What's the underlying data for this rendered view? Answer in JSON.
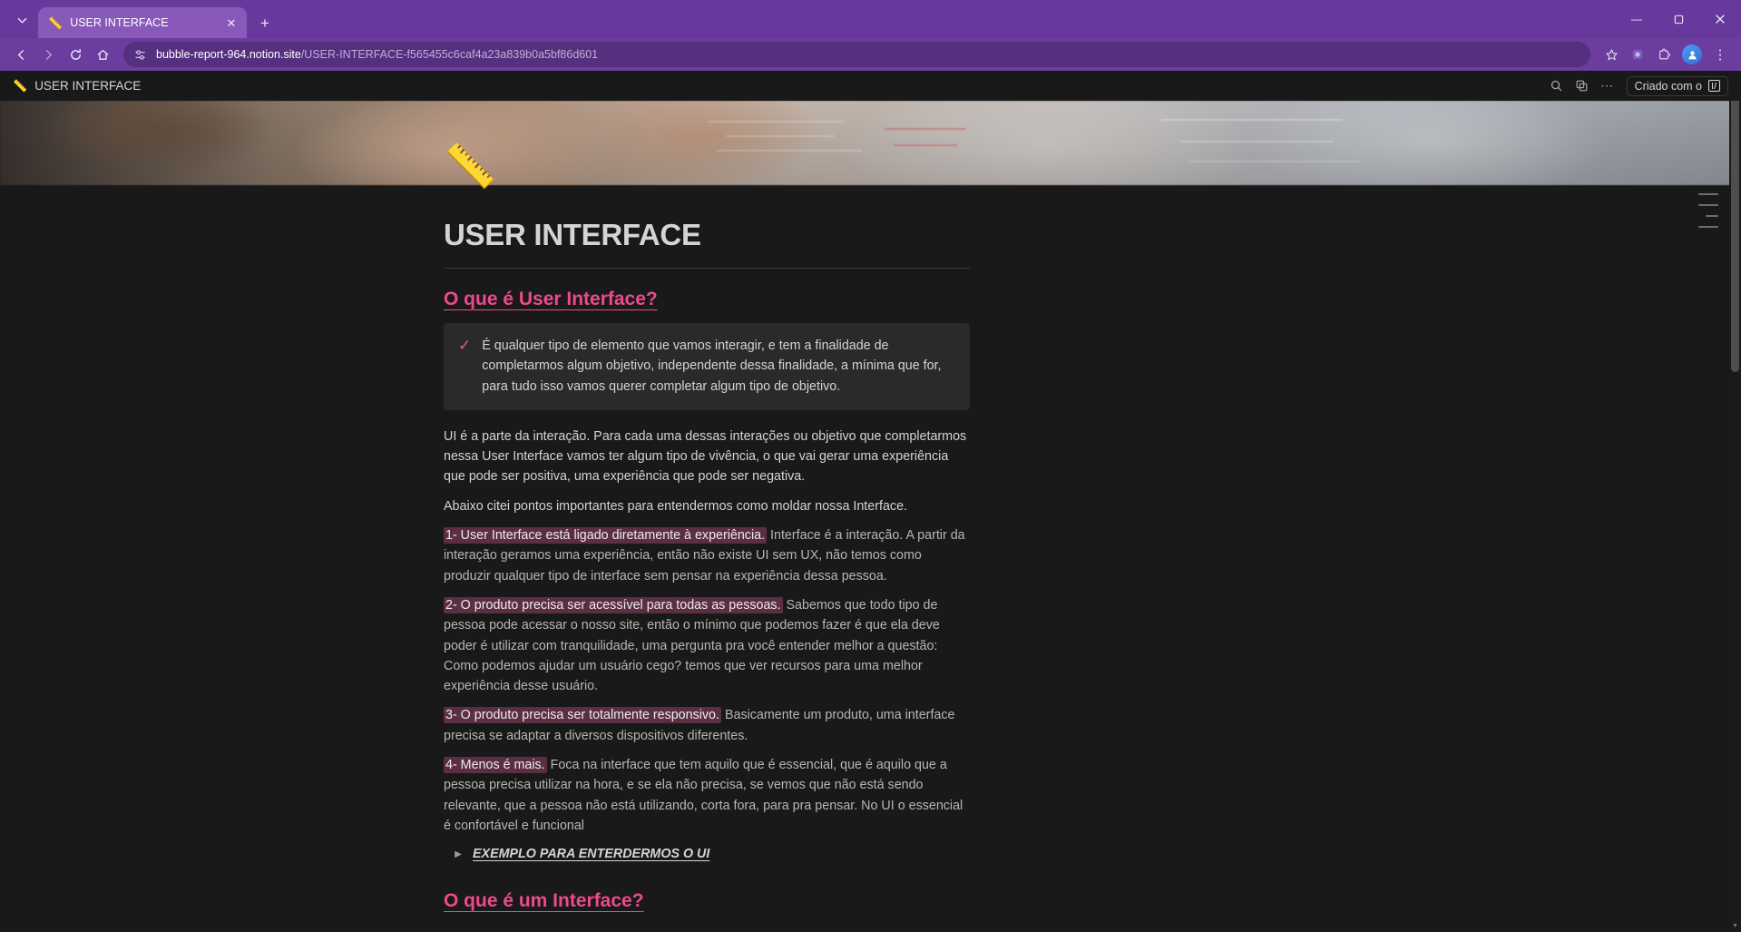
{
  "browser": {
    "tab": {
      "favicon": "ruler-emoji",
      "title": "USER INTERFACE",
      "close_label": "✕"
    },
    "new_tab_label": "+",
    "tab_search_label": "⌄",
    "window_controls": {
      "minimize": "—",
      "maximize": "❐",
      "close": "✕"
    },
    "nav": {
      "back": "←",
      "forward": "→",
      "reload": "⟳",
      "home": "⌂"
    },
    "omnibox": {
      "site_info_icon": "site-settings-icon",
      "domain": "bubble-report-964.notion.site",
      "path": "/USER-INTERFACE-f565455c6caf4a23a839b0a5bf86d601",
      "bookmark_icon": "☆"
    },
    "toolbar_right": {
      "extension_puzzle": "⧉",
      "extensions": "❖",
      "profile_initial": "●",
      "menu": "⋮"
    },
    "theme_color": "#67399c"
  },
  "notion_topbar": {
    "emoji": "📏",
    "title": "USER INTERFACE",
    "search_icon": "search-icon",
    "duplicate_icon": "duplicate-icon",
    "more_icon": "⋯",
    "made_with_label": "Criado com o"
  },
  "page": {
    "icon": "📏",
    "title": "USER INTERFACE",
    "sections": [
      {
        "heading": "O que é User Interface?",
        "callout": {
          "icon": "✓",
          "text": "É qualquer tipo de elemento que vamos interagir, e tem a finalidade de completarmos algum objetivo, independente dessa finalidade, a mínima que for, para tudo isso vamos querer completar algum tipo de objetivo."
        },
        "paragraphs": [
          "UI é a parte da interação. Para cada uma dessas interações ou objetivo que completarmos nessa User Interface vamos ter algum tipo de vivência, o que vai gerar uma experiência que pode ser positiva, uma experiência que pode ser negativa.",
          "Abaixo citei pontos importantes para entendermos como moldar nossa Interface."
        ],
        "points": [
          {
            "highlight": "1- User Interface está ligado diretamente à experiência.",
            "rest": " Interface é a interação. A partir da interação geramos uma experiência, então não existe UI sem UX, não temos como produzir qualquer tipo de interface sem pensar na experiência dessa pessoa."
          },
          {
            "highlight": "2- O produto precisa ser acessível para todas as pessoas.",
            "rest": "  Sabemos que todo tipo de pessoa pode acessar o nosso site, então o mínimo que podemos fazer é que ela deve poder é utilizar com tranquilidade, uma pergunta pra você entender melhor a questão: Como podemos ajudar um usuário cego? temos que ver recursos para uma melhor experiência desse usuário."
          },
          {
            "highlight": "3- O produto precisa ser totalmente responsivo.",
            "rest": " Basicamente um produto, uma interface precisa se adaptar a diversos dispositivos diferentes."
          },
          {
            "highlight": "4- Menos é mais.",
            "rest": "  Foca na interface que tem aquilo que é essencial, que é aquilo que a pessoa precisa utilizar na hora, e se ela não precisa, se vemos que não está sendo relevante, que a pessoa não está utilizando, corta fora, para pra pensar. No UI o essencial é confortável e funcional"
          }
        ],
        "toggle": {
          "arrow": "▶",
          "label": "EXEMPLO PARA ENTERDERMOS O UI"
        }
      },
      {
        "heading": "O que é um Interface?"
      }
    ],
    "accent_color": "#ed4a8c",
    "highlight_bg": "#5c2e43",
    "background": "#191919"
  },
  "toc": {
    "marks": 4
  }
}
